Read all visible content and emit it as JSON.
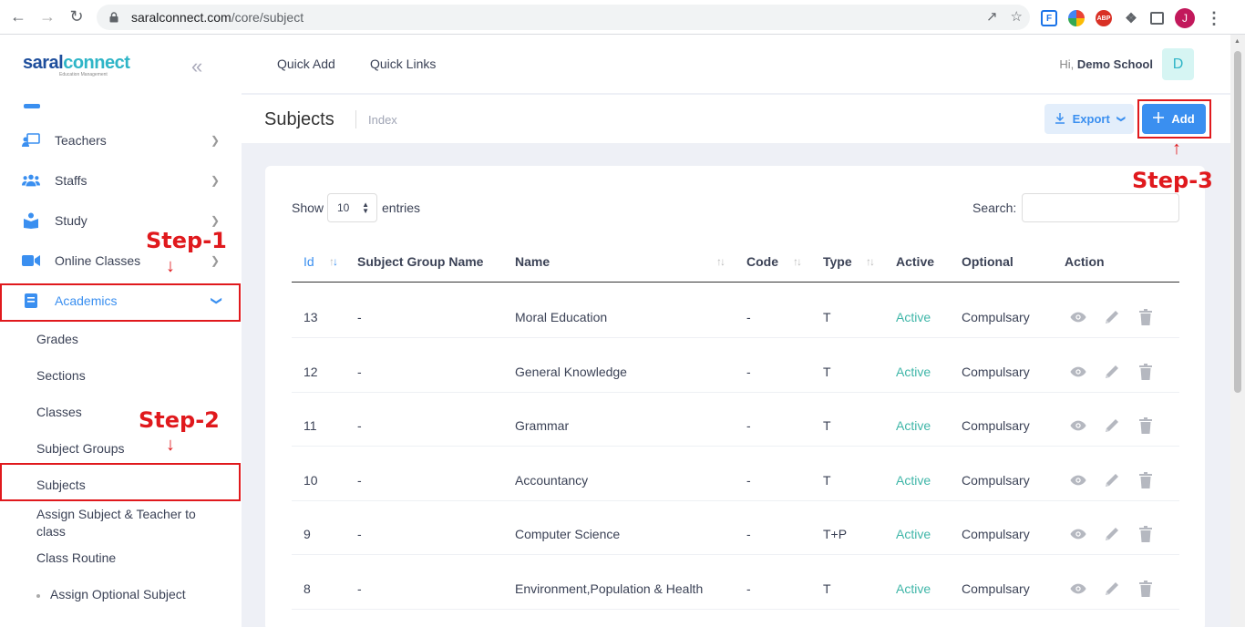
{
  "browser": {
    "url_host": "saralconnect.com",
    "url_path": "/core/subject",
    "profile_initial": "J",
    "ext_abp": "ABP",
    "ext_f": "F"
  },
  "logo": {
    "part1": "saral",
    "part2": "connect",
    "sub": "Education Management"
  },
  "sidebar": {
    "items": [
      {
        "label": "Teachers"
      },
      {
        "label": "Staffs"
      },
      {
        "label": "Study"
      },
      {
        "label": "Online Classes"
      },
      {
        "label": "Academics"
      }
    ],
    "sub_items": [
      {
        "label": "Grades"
      },
      {
        "label": "Sections"
      },
      {
        "label": "Classes"
      },
      {
        "label": "Subject Groups"
      },
      {
        "label": "Subjects"
      },
      {
        "label": "Assign Subject & Teacher to class"
      },
      {
        "label": "Class Routine"
      },
      {
        "label": "Assign Optional Subject"
      }
    ]
  },
  "annotations": {
    "step1": "Step-1",
    "step2": "Step-2",
    "step3": "Step-3"
  },
  "header": {
    "quick_add": "Quick Add",
    "quick_links": "Quick Links",
    "greeting": "Hi,",
    "school": "Demo School",
    "avatar_initial": "D"
  },
  "page": {
    "title": "Subjects",
    "subtitle": "Index",
    "export_label": "Export",
    "add_label": "Add"
  },
  "table_controls": {
    "show": "Show",
    "entries_value": "10",
    "entries": "entries",
    "search": "Search:",
    "search_value": ""
  },
  "table": {
    "headers": [
      "Id",
      "Subject Group Name",
      "Name",
      "Code",
      "Type",
      "Active",
      "Optional",
      "Action"
    ],
    "rows": [
      {
        "id": "13",
        "group": "-",
        "name": "Moral Education",
        "code": "-",
        "type": "T",
        "active": "Active",
        "optional": "Compulsary"
      },
      {
        "id": "12",
        "group": "-",
        "name": "General Knowledge",
        "code": "-",
        "type": "T",
        "active": "Active",
        "optional": "Compulsary"
      },
      {
        "id": "11",
        "group": "-",
        "name": "Grammar",
        "code": "-",
        "type": "T",
        "active": "Active",
        "optional": "Compulsary"
      },
      {
        "id": "10",
        "group": "-",
        "name": "Accountancy",
        "code": "-",
        "type": "T",
        "active": "Active",
        "optional": "Compulsary"
      },
      {
        "id": "9",
        "group": "-",
        "name": "Computer Science",
        "code": "-",
        "type": "T+P",
        "active": "Active",
        "optional": "Compulsary"
      },
      {
        "id": "8",
        "group": "-",
        "name": "Environment,Population & Health",
        "code": "-",
        "type": "T",
        "active": "Active",
        "optional": "Compulsary"
      }
    ]
  },
  "colors": {
    "accent": "#3a8ff0",
    "active_green": "#3fb6a8",
    "annotation_red": "#e0191d"
  }
}
